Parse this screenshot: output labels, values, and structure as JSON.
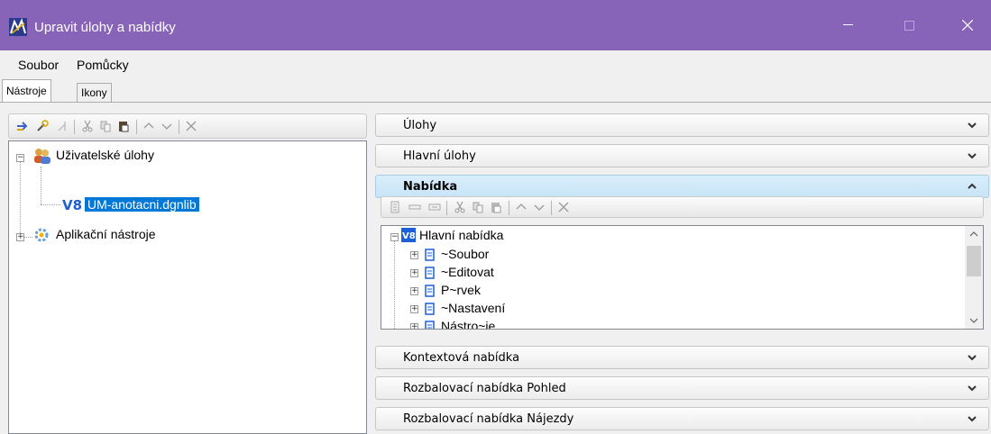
{
  "window": {
    "title": "Upravit úlohy a nabídky"
  },
  "menu": {
    "soubor": "Soubor",
    "pomucky": "Pomůcky"
  },
  "tabs": {
    "nastroje": "Nástroje",
    "ikony": "Ikony"
  },
  "left_tree": {
    "user_tasks": "Uživatelské úlohy",
    "um_lib": "UM-anotacni.dgnlib",
    "app_tools": "Aplikační nástroje"
  },
  "accordion": {
    "ulohy": "Úlohy",
    "hlavni_ulohy": "Hlavní úlohy",
    "nabidka": "Nabídka",
    "kontextova": "Kontextová nabídka",
    "pohled": "Rozbalovací nabídka Pohled",
    "najezdy": "Rozbalovací nabídka Nájezdy"
  },
  "menu_tree": {
    "root": "Hlavní nabídka",
    "items": [
      "~Soubor",
      "~Editovat",
      "P~rvek",
      "~Nastavení",
      "Nástro~je"
    ]
  },
  "colors": {
    "titlebar": "#8764b8",
    "selection": "#0078d7",
    "open_section": "#cfe8f8"
  }
}
